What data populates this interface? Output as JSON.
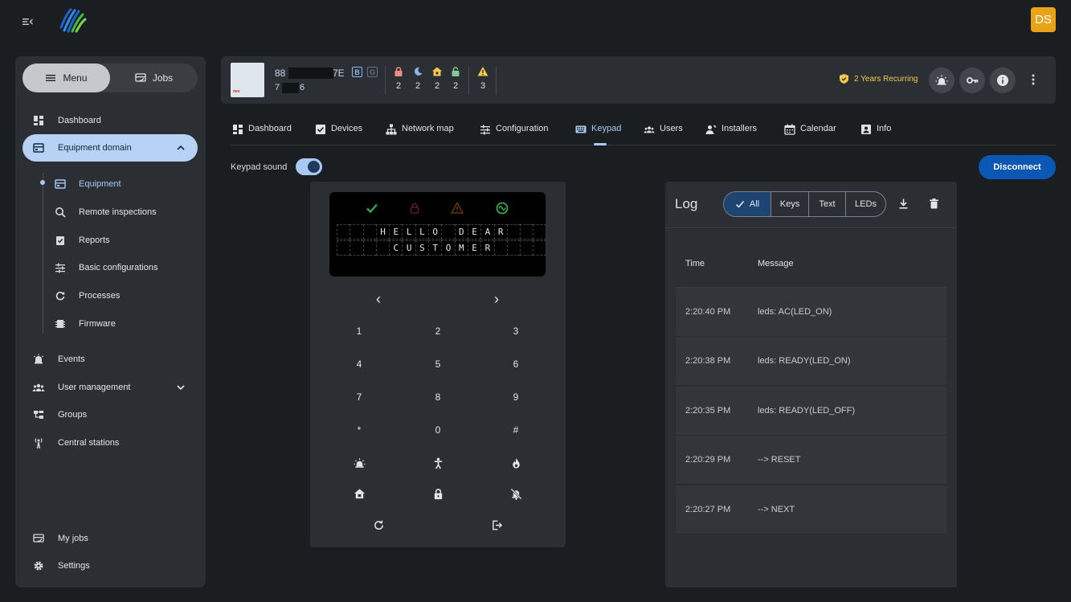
{
  "topbar": {
    "avatar_initials": "DS",
    "avatar_color": "#e8a317"
  },
  "sidebar": {
    "toggle": {
      "menu": "Menu",
      "jobs": "Jobs"
    },
    "items": [
      {
        "label": "Dashboard",
        "icon": "dashboard-icon"
      },
      {
        "label": "Equipment domain",
        "icon": "equipment-domain-icon",
        "selected": true,
        "expanded": true
      },
      {
        "label": "Events",
        "icon": "alarm-icon"
      },
      {
        "label": "User management",
        "icon": "people-icon",
        "collapsible": true
      },
      {
        "label": "Groups",
        "icon": "groups-icon"
      },
      {
        "label": "Central stations",
        "icon": "central-station-icon"
      }
    ],
    "sub_items": [
      {
        "label": "Equipment",
        "icon": "equipment-icon",
        "current": true
      },
      {
        "label": "Remote inspections",
        "icon": "remote-inspection-icon"
      },
      {
        "label": "Reports",
        "icon": "report-icon"
      },
      {
        "label": "Basic configurations",
        "icon": "sliders-icon"
      },
      {
        "label": "Processes",
        "icon": "process-icon"
      },
      {
        "label": "Firmware",
        "icon": "firmware-icon"
      }
    ],
    "bottom": [
      {
        "label": "My jobs",
        "icon": "my-jobs-icon"
      },
      {
        "label": "Settings",
        "icon": "gear-icon"
      }
    ]
  },
  "device": {
    "id_prefix": "88",
    "id_suffix": "7E",
    "sub_prefix": "7",
    "sub_suffix": "6",
    "badge_b": "B",
    "badge_g": "G",
    "stats": [
      {
        "icon": "lock-icon",
        "value": "2",
        "color": "#f28b82"
      },
      {
        "icon": "moon-icon",
        "value": "2",
        "color": "#8db4ea"
      },
      {
        "icon": "home-lock-icon",
        "value": "2",
        "color": "#f2c94c"
      },
      {
        "icon": "unlock-icon",
        "value": "2",
        "color": "#81c995"
      },
      {
        "icon": "warning-icon",
        "value": "3",
        "color": "#f2c94c"
      }
    ],
    "plan_label": "2 Years Recurring",
    "thumb_label": "nev"
  },
  "tabs": [
    {
      "label": "Dashboard",
      "icon": "dashboard-icon"
    },
    {
      "label": "Devices",
      "icon": "devices-icon"
    },
    {
      "label": "Network map",
      "icon": "network-icon"
    },
    {
      "label": "Configuration",
      "icon": "configuration-icon"
    },
    {
      "label": "Keypad",
      "icon": "keyboard-icon",
      "active": true
    },
    {
      "label": "Users",
      "icon": "users-icon"
    },
    {
      "label": "Installers",
      "icon": "installers-icon"
    },
    {
      "label": "Calendar",
      "icon": "calendar-icon"
    },
    {
      "label": "Info",
      "icon": "info-icon"
    }
  ],
  "keypad_sound": {
    "label": "Keypad sound",
    "on": true
  },
  "disconnect_label": "Disconnect",
  "keypad": {
    "lcd_line1": "   HELLO DEAR   ",
    "lcd_line2": "    CUSTOMER    ",
    "leds": [
      {
        "name": "ready-led-icon",
        "color": "#34a853"
      },
      {
        "name": "armed-led-icon",
        "color": "#6e1f1f"
      },
      {
        "name": "trouble-led-icon",
        "color": "#7a3d12"
      },
      {
        "name": "ac-led-icon",
        "color": "#34a853"
      }
    ],
    "nav": {
      "left": "‹",
      "right": "›"
    },
    "keys": [
      "1",
      "2",
      "3",
      "4",
      "5",
      "6",
      "7",
      "8",
      "9",
      "*",
      "0",
      "#"
    ]
  },
  "log": {
    "title": "Log",
    "filters": [
      {
        "label": "All",
        "active": true
      },
      {
        "label": "Keys"
      },
      {
        "label": "Text"
      },
      {
        "label": "LEDs"
      }
    ],
    "columns": {
      "time": "Time",
      "message": "Message"
    },
    "rows": [
      {
        "time": "2:20:40 PM",
        "message": "leds: AC(LED_ON)"
      },
      {
        "time": "2:20:38 PM",
        "message": "leds: READY(LED_ON)"
      },
      {
        "time": "2:20:35 PM",
        "message": "leds: READY(LED_OFF)"
      },
      {
        "time": "2:20:29 PM",
        "message": "--> RESET"
      },
      {
        "time": "2:20:27 PM",
        "message": "--> NEXT"
      }
    ]
  }
}
